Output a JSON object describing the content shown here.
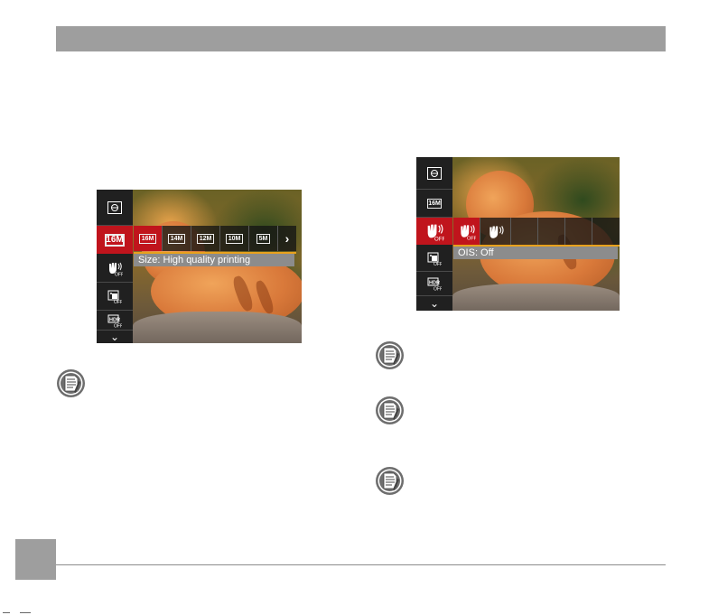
{
  "left_screen": {
    "caption": "Size: High quality printing",
    "sidebar_icons": [
      "exposure-icon",
      "image-size-16m-icon",
      "ois-off-icon",
      "color-effect-off-icon",
      "hdr-off-icon"
    ],
    "active_index": 1,
    "size_16m_label": "16M",
    "options": [
      "16M",
      "14M",
      "12M",
      "10M",
      "5M"
    ],
    "selected_option": 0,
    "more_arrow": "›",
    "scroll_down": "⌄"
  },
  "right_screen": {
    "caption": "OIS: Off",
    "sidebar_icons": [
      "exposure-icon",
      "image-size-16m-icon",
      "ois-off-icon",
      "color-effect-off-icon",
      "hdr-off-icon"
    ],
    "active_index": 2,
    "size_16m_label": "16M",
    "options": [
      "ois-off",
      "ois-on"
    ],
    "selected_option": 0,
    "scroll_down": "⌄"
  },
  "note_icons": 4
}
